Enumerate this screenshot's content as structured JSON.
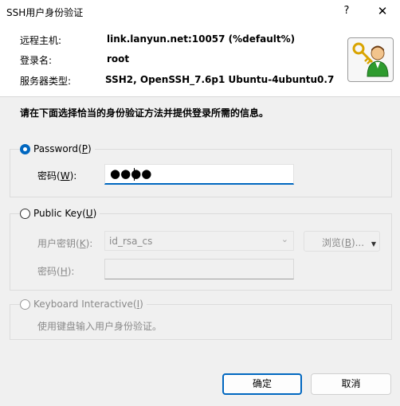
{
  "window": {
    "title": "SSH用户身份验证",
    "help_glyph": "?",
    "close_glyph": "✕"
  },
  "info": {
    "host_label": "远程主机:",
    "host_value": "link.lanyun.net:10057 (%default%)",
    "login_label": "登录名:",
    "login_value": "root",
    "server_label": "服务器类型:",
    "server_value": "SSH2, OpenSSH_7.6p1 Ubuntu-4ubuntu0.7",
    "avatar_icon": "key-user-icon"
  },
  "instruction": "请在下面选择恰当的身份验证方法并提供登录所需的信息。",
  "password_method": {
    "label": "Password",
    "mnemonic": "P",
    "selected": true,
    "field_label": "密码",
    "field_mnemonic": "W",
    "value_masked": "●●●●"
  },
  "publickey_method": {
    "label": "Public Key",
    "mnemonic": "U",
    "selected": false,
    "key_label": "用户密钥",
    "key_mnemonic": "K",
    "key_value": "id_rsa_cs",
    "browse_label": "浏览",
    "browse_mnemonic": "B",
    "passphrase_label": "密码",
    "passphrase_mnemonic": "H"
  },
  "keyboard_method": {
    "label": "Keyboard Interactive",
    "mnemonic": "I",
    "selected": false,
    "description": "使用键盘输入用户身份验证。"
  },
  "buttons": {
    "ok": "确定",
    "cancel": "取消"
  },
  "colors": {
    "accent": "#0067c0",
    "disabled_text": "#8a8a8a"
  }
}
